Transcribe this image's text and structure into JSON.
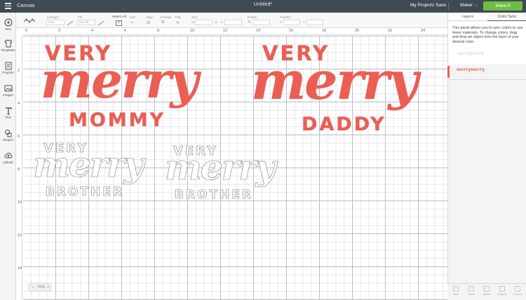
{
  "topbar": {
    "app_title": "Canvas",
    "document_title": "Untitled*",
    "my_projects": "My Projects",
    "save": "Save",
    "machine": "Maker",
    "make_button": "Make It"
  },
  "toolbar": {
    "linetype_label": "Linetype",
    "linetype_value": "Cut",
    "fill_label": "Fill",
    "fill_value": "No Fill",
    "select_all": "Select All",
    "edit_label": "Edit",
    "align_label": "Align",
    "arrange_label": "Arrange",
    "flip_label": "Flip",
    "size_label": "Size",
    "size_w": "W",
    "size_h": "H",
    "rotate_label": "Rotate",
    "position_label": "Position",
    "position_x": "X",
    "position_y": "Y"
  },
  "sidebar": {
    "items": [
      {
        "label": "New",
        "icon": "plus-circle-icon"
      },
      {
        "label": "Templates",
        "icon": "shirt-icon"
      },
      {
        "label": "Projects",
        "icon": "projects-icon"
      },
      {
        "label": "Images",
        "icon": "image-icon"
      },
      {
        "label": "Text",
        "icon": "text-icon"
      },
      {
        "label": "Shapes",
        "icon": "shapes-icon"
      },
      {
        "label": "Upload",
        "icon": "upload-cloud-icon"
      }
    ]
  },
  "ruler": {
    "h_ticks": [
      "0",
      "2",
      "4",
      "6",
      "8",
      "10",
      "12",
      "14",
      "16",
      "18",
      "20",
      "22",
      "24"
    ],
    "v_ticks": [
      "2",
      "4",
      "6",
      "8",
      "10",
      "12",
      "14"
    ]
  },
  "designs": [
    {
      "top": "VERY",
      "script": "merry",
      "bottom": "MOMMY",
      "style": "red"
    },
    {
      "top": "VERY",
      "script": "merry",
      "bottom": "DADDY",
      "style": "red"
    },
    {
      "top": "VERY",
      "script": "merry",
      "bottom": "BROTHER",
      "style": "outline"
    },
    {
      "top": "VERY",
      "script": "merry",
      "bottom": "BROTHER",
      "style": "outline"
    }
  ],
  "zoom": {
    "value": "75%",
    "minus": "−",
    "plus": "+"
  },
  "panel": {
    "tab_layers": "Layers",
    "tab_color_sync": "Color Sync",
    "description": "This panel allows you to sync colors to use fewer materials. To change colors, drag and drop an object onto the layer of your desired color.",
    "swatch_label": "merry",
    "ghost_label": "merry"
  },
  "bottom_tools": [
    "Slice",
    "Weld",
    "Attach",
    "Flatten",
    "Contour"
  ],
  "colors": {
    "accent_red": "#ec5e54",
    "make_green": "#6fbe44",
    "topbar": "#3f4a55"
  }
}
